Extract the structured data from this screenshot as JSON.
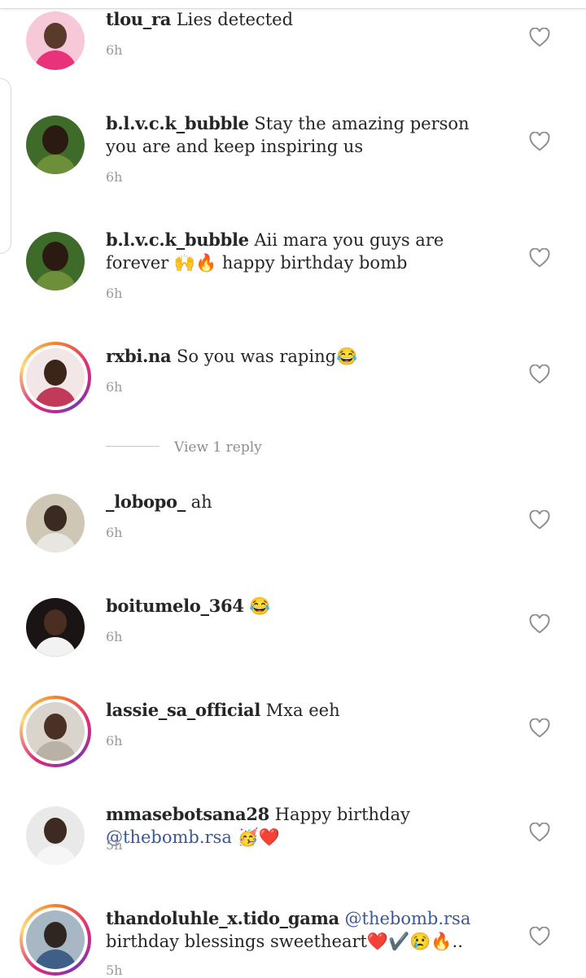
{
  "reply_link": "View 1 reply",
  "comments": [
    {
      "username": "tlou_ra",
      "text": " Lies detected",
      "time": "6h"
    },
    {
      "username": "b.l.v.c.k_bubble",
      "text": " Stay the amazing person you are and keep inspiring us",
      "time": "6h"
    },
    {
      "username": "b.l.v.c.k_bubble",
      "text": " Aii mara you guys are forever 🙌🔥 happy birthday bomb",
      "time": "6h"
    },
    {
      "username": "rxbi.na",
      "text": " So you was raping😂",
      "time": "6h"
    },
    {
      "username": "_lobopo_",
      "text": " ah",
      "time": "6h"
    },
    {
      "username": "boitumelo_364",
      "text": " 😂",
      "time": "6h"
    },
    {
      "username": "lassie_sa_official",
      "text": " Mxa eeh",
      "time": "6h"
    },
    {
      "username": "mmasebotsana28",
      "text": " Happy birthday ",
      "mention": "@thebomb.rsa",
      "text_after": " 🥳❤️",
      "time": "5h"
    },
    {
      "username": "thandoluhle_x.tido_gama",
      "text": " ",
      "mention": "@thebomb.rsa",
      "text_after": " birthday blessings sweetheart❤️✔️😢🔥..",
      "time": "5h"
    }
  ],
  "icons": {
    "like": "heart-outline-icon"
  },
  "colors": {
    "mention": "#385898",
    "timestamp": "#9a9a9a",
    "story_ring": "#dd2a7b"
  }
}
